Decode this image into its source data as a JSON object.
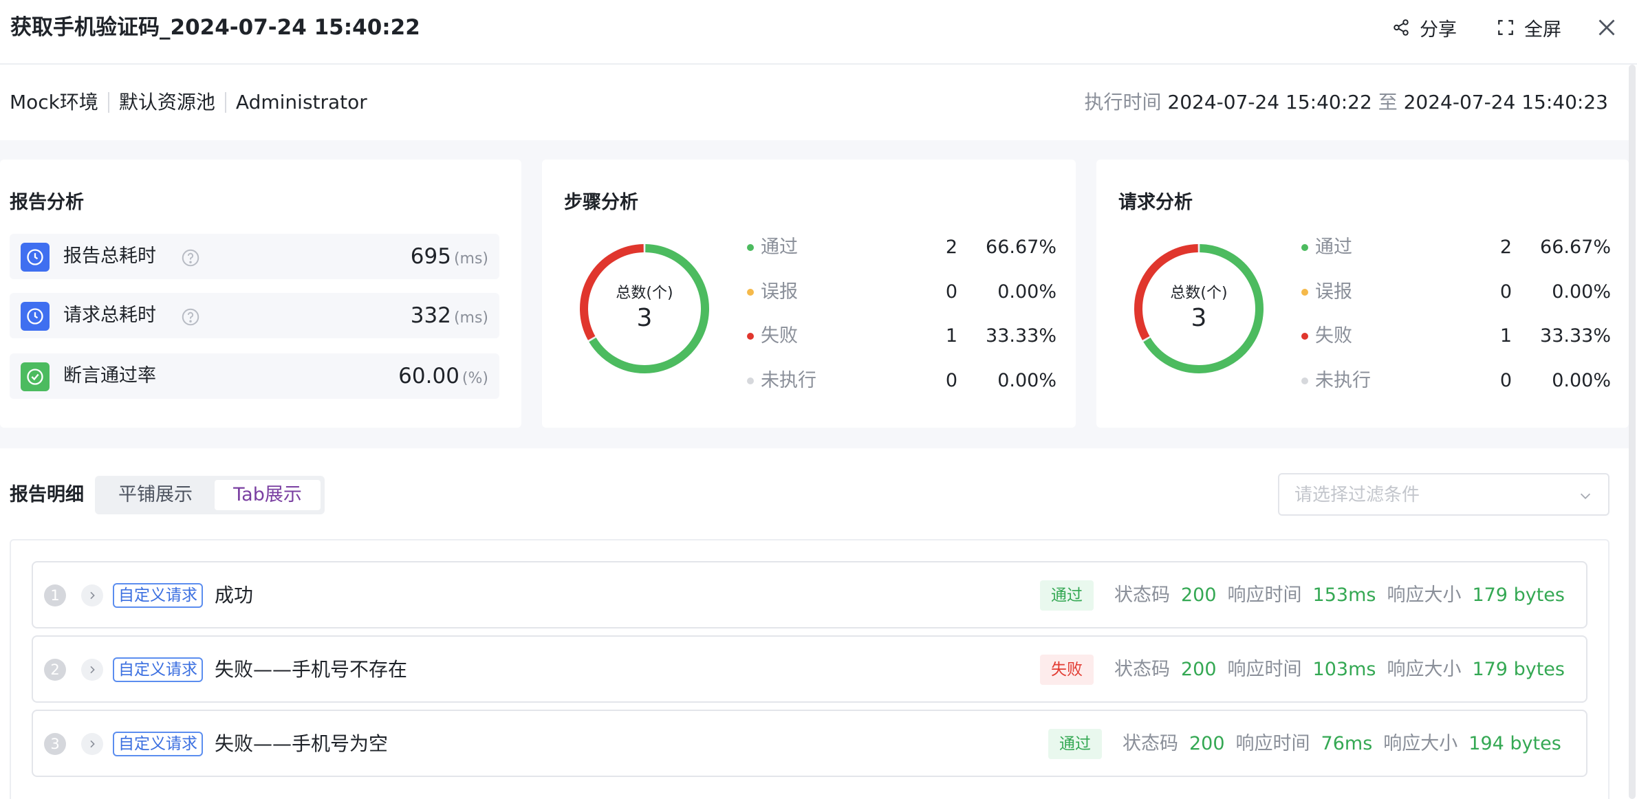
{
  "header": {
    "title": "获取手机验证码_2024-07-24 15:40:22",
    "share_label": "分享",
    "fullscreen_label": "全屏"
  },
  "info": {
    "environment": "Mock环境",
    "resource_pool": "默认资源池",
    "user": "Administrator",
    "exec_label": "执行时间",
    "start_time": "2024-07-24 15:40:22",
    "to_label": "至",
    "end_time": "2024-07-24 15:40:23"
  },
  "report_analysis": {
    "title": "报告分析",
    "metrics": [
      {
        "label": "报告总耗时",
        "value": "695",
        "unit": "(ms)",
        "icon": "clock-icon"
      },
      {
        "label": "请求总耗时",
        "value": "332",
        "unit": "(ms)",
        "icon": "clock-icon"
      },
      {
        "label": "断言通过率",
        "value": "60.00",
        "unit": "(%)",
        "icon": "check-circle-icon"
      }
    ]
  },
  "step_analysis": {
    "title": "步骤分析",
    "total_label": "总数(个)",
    "total": "3",
    "legend": [
      {
        "name": "通过",
        "count": "2",
        "pct": "66.67%",
        "color": "#4cbb5f"
      },
      {
        "name": "误报",
        "count": "0",
        "pct": "0.00%",
        "color": "#f5b94a"
      },
      {
        "name": "失败",
        "count": "1",
        "pct": "33.33%",
        "color": "#e0362d"
      },
      {
        "name": "未执行",
        "count": "0",
        "pct": "0.00%",
        "color": "#d6d8dc"
      }
    ]
  },
  "request_analysis": {
    "title": "请求分析",
    "total_label": "总数(个)",
    "total": "3",
    "legend": [
      {
        "name": "通过",
        "count": "2",
        "pct": "66.67%",
        "color": "#4cbb5f"
      },
      {
        "name": "误报",
        "count": "0",
        "pct": "0.00%",
        "color": "#f5b94a"
      },
      {
        "name": "失败",
        "count": "1",
        "pct": "33.33%",
        "color": "#e0362d"
      },
      {
        "name": "未执行",
        "count": "0",
        "pct": "0.00%",
        "color": "#d6d8dc"
      }
    ]
  },
  "detail": {
    "title": "报告明细",
    "tab_flat": "平铺展示",
    "tab_tab": "Tab展示",
    "filter_placeholder": "请选择过滤条件",
    "status_code_label": "状态码",
    "response_time_label": "响应时间",
    "response_size_label": "响应大小",
    "rows": [
      {
        "index": "1",
        "tag": "自定义请求",
        "name": "成功",
        "status": "通过",
        "code": "200",
        "time": "153ms",
        "size": "179 bytes"
      },
      {
        "index": "2",
        "tag": "自定义请求",
        "name": "失败——手机号不存在",
        "status": "失败",
        "code": "200",
        "time": "103ms",
        "size": "179 bytes"
      },
      {
        "index": "3",
        "tag": "自定义请求",
        "name": "失败——手机号为空",
        "status": "通过",
        "code": "200",
        "time": "76ms",
        "size": "194 bytes"
      }
    ]
  },
  "colors": {
    "pass": "#4cbb5f",
    "fail": "#e0362d",
    "accent_purple": "#7a3fa1",
    "tag_blue": "#3b6fe0"
  }
}
